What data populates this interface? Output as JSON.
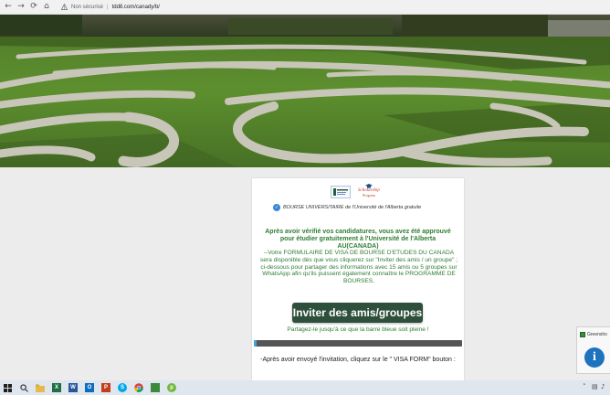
{
  "browser": {
    "back_glyph": "←",
    "forward_glyph": "→",
    "reload_glyph": "⟳",
    "home_glyph": "⌂",
    "security_label": "Non sécurisé",
    "separator": "|",
    "url": "tdd8.com/canady/b/"
  },
  "card": {
    "logos": {
      "university_label": "",
      "scholarship_title": "Scholarship",
      "scholarship_sub": "Program"
    },
    "badge_check": "✓",
    "badge_text": "BOURSE UNIVERSITAIRE de l'Université de l'Alberta gratuite",
    "headline": "Après avoir vérifié vos candidatures, vous avez été approuvé pour étudier gratuitement à l'Université de l'Alberta AU(CANADA)",
    "body": "--Votre FORMULAIRE DE VISA DE BOURSE D'ETUDES DU CANADA sera disponible dès que vous cliquerez sur \"Inviter des amis / un groupe\" ; ci-dessous pour partager des informations avec 15 amis ou 5 groupes sur WhatsApp afin qu'ils puissent également connaître le PROGRAMME DE BOURSES.",
    "invite_button": "Inviter des amis/groupes",
    "share_line": "Partagez-le jusqu'à ce que la barre bleue soit pleine !",
    "progress_fraction": 0.012,
    "after_text": "-Après avoir envoyé l'invitation, cliquez sur le \" VISA FORM\" bouton :"
  },
  "greenshot": {
    "label": "Greensho",
    "info_glyph": "i"
  },
  "taskbar": {
    "icons": [
      "windows-start-icon",
      "search-icon",
      "file-explorer-icon",
      "excel-icon",
      "word-icon",
      "outlook-icon",
      "powerpoint-icon",
      "skype-icon",
      "chrome-icon",
      "greenshot-icon",
      "utorrent-icon"
    ]
  },
  "colors": {
    "accent_green": "#2e7d32",
    "button_bg": "#2e4f3c",
    "progress_track": "#555555",
    "progress_fill": "#40a4d8"
  }
}
